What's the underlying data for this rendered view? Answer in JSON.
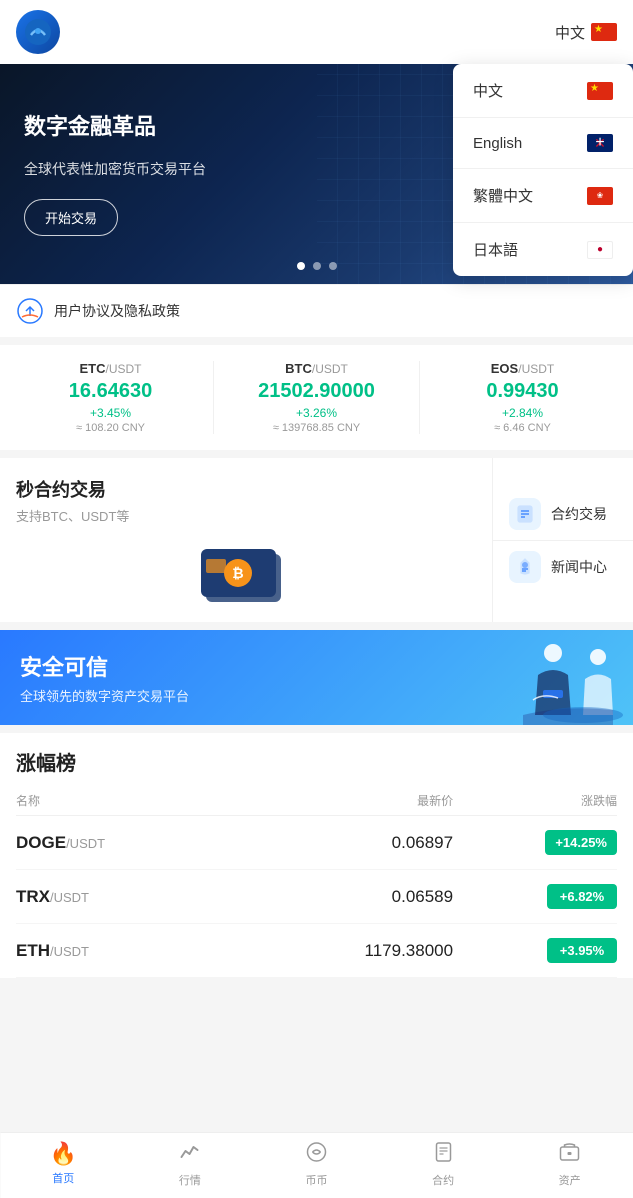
{
  "header": {
    "logo_alt": "Logo",
    "lang_label": "中文"
  },
  "lang_dropdown": {
    "items": [
      {
        "label": "中文",
        "flag": "cn"
      },
      {
        "label": "English",
        "flag": "uk"
      },
      {
        "label": "繁體中文",
        "flag": "hk"
      },
      {
        "label": "日本語",
        "flag": "jp"
      }
    ]
  },
  "banner": {
    "title": "数字金融革品",
    "subtitle": "全球代表性加密货币交易平台",
    "start_btn": "开始交易",
    "dots": [
      1,
      2,
      3
    ]
  },
  "notice": {
    "text": "用户协议及隐私政策"
  },
  "prices": [
    {
      "pair": "ETC/USDT",
      "pair_base": "ETC",
      "pair_quote": "USDT",
      "value": "16.64630",
      "change": "+3.45%",
      "cny": "≈ 108.20 CNY"
    },
    {
      "pair": "BTC/USDT",
      "pair_base": "BTC",
      "pair_quote": "USDT",
      "value": "21502.90000",
      "change": "+3.26%",
      "cny": "≈ 139768.85 CNY"
    },
    {
      "pair": "EOS/USDT",
      "pair_base": "EOS",
      "pair_quote": "USDT",
      "value": "0.99430",
      "change": "+2.84%",
      "cny": "≈ 6.46 CNY"
    }
  ],
  "trading": {
    "title": "秒合约交易",
    "subtitle": "支持BTC、USDT等",
    "buttons": [
      {
        "label": "合约交易",
        "icon": "📄"
      },
      {
        "label": "新闻中心",
        "icon": "🎓"
      }
    ]
  },
  "promo": {
    "title": "安全可信",
    "subtitle": "全球领先的数字资产交易平台"
  },
  "market_table": {
    "title": "涨幅榜",
    "headers": [
      "名称",
      "最新价",
      "涨跌幅"
    ],
    "rows": [
      {
        "base": "DOGE",
        "quote": "USDT",
        "price": "0.06897",
        "change": "+14.25%"
      },
      {
        "base": "TRX",
        "quote": "USDT",
        "price": "0.06589",
        "change": "+6.82%"
      },
      {
        "base": "ETH",
        "quote": "USDT",
        "price": "1179.38000",
        "change": "+3.95%"
      }
    ]
  },
  "bottom_nav": {
    "items": [
      {
        "label": "首页",
        "icon": "🔥",
        "active": true
      },
      {
        "label": "行情",
        "icon": "📈",
        "active": false
      },
      {
        "label": "币币",
        "icon": "🔄",
        "active": false
      },
      {
        "label": "合约",
        "icon": "📋",
        "active": false
      },
      {
        "label": "资产",
        "icon": "💼",
        "active": false
      }
    ]
  }
}
